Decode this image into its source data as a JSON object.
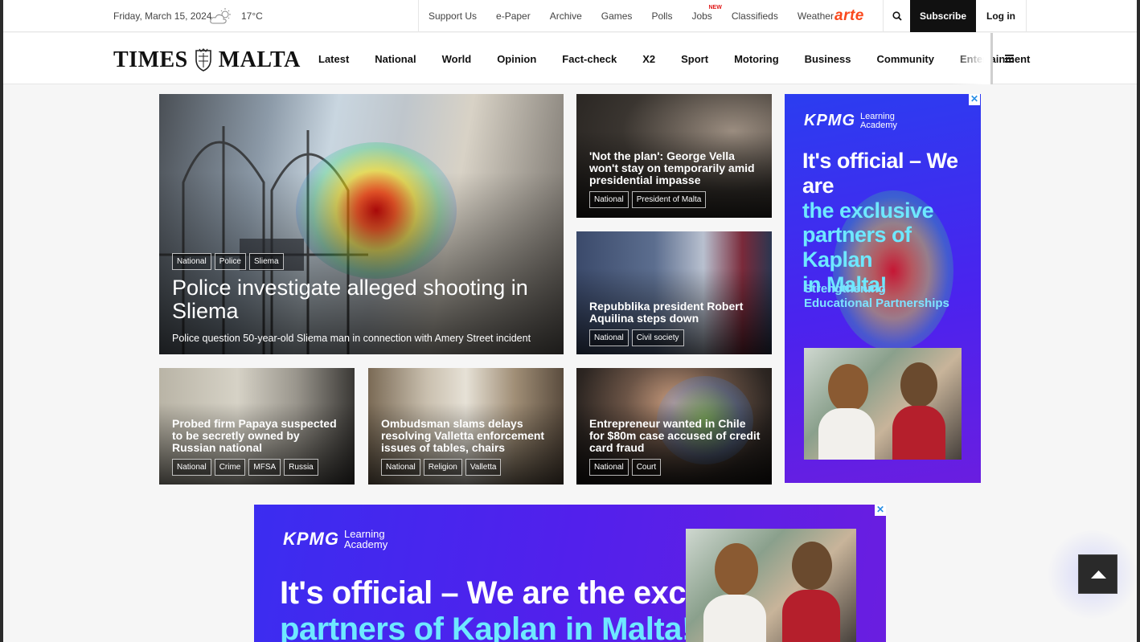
{
  "topbar": {
    "date": "Friday, March 15, 2024",
    "weather_icon": "partly-cloudy-icon",
    "temperature": "17°C",
    "links": [
      {
        "label": "Support Us"
      },
      {
        "label": "e-Paper"
      },
      {
        "label": "Archive"
      },
      {
        "label": "Games"
      },
      {
        "label": "Polls"
      },
      {
        "label": "Jobs",
        "badge": "NEW"
      },
      {
        "label": "Classifieds"
      },
      {
        "label": "Weather"
      }
    ],
    "partner_logo": "arte",
    "subscribe_label": "Subscribe",
    "login_label": "Log in"
  },
  "nav": {
    "logo_left": "TIMES",
    "logo_right": "MALTA",
    "items": [
      {
        "label": "Latest"
      },
      {
        "label": "National"
      },
      {
        "label": "World"
      },
      {
        "label": "Opinion"
      },
      {
        "label": "Fact-check"
      },
      {
        "label": "X2"
      },
      {
        "label": "Sport"
      },
      {
        "label": "Motoring"
      },
      {
        "label": "Business"
      },
      {
        "label": "Community"
      },
      {
        "label": "Entertainment"
      }
    ]
  },
  "articles": {
    "lead": {
      "tags": [
        "National",
        "Police",
        "Sliema"
      ],
      "headline": "Police investigate alleged shooting in Sliema",
      "subhead": "Police question 50-year-old Sliema man in connection with Amery Street incident"
    },
    "vella": {
      "headline": "'Not the plan': George Vella won't stay on temporarily amid presidential impasse",
      "tags": [
        "National",
        "President of Malta"
      ]
    },
    "aquilina": {
      "headline": "Repubblika president Robert Aquilina steps down",
      "tags": [
        "National",
        "Civil society"
      ]
    },
    "papaya": {
      "headline": "Probed firm Papaya suspected to be secretly owned by Russian national",
      "tags": [
        "National",
        "Crime",
        "MFSA",
        "Russia"
      ]
    },
    "ombudsman": {
      "headline": "Ombudsman slams delays resolving Valletta enforcement issues of tables, chairs",
      "tags": [
        "National",
        "Religion",
        "Valletta"
      ]
    },
    "chile": {
      "headline": "Entrepreneur wanted in Chile for $80m case accused of credit card fraud",
      "tags": [
        "National",
        "Court"
      ]
    }
  },
  "ads": {
    "side": {
      "brand": "KPMG",
      "brand_sub_1": "Learning",
      "brand_sub_2": "Academy",
      "headline_1": "It's official – We are",
      "headline_2": "the exclusive",
      "headline_3": "partners of Kaplan",
      "headline_4": "in Malta!",
      "subline_1": "Strengthening",
      "subline_2": "Educational Partnerships",
      "close": "✕"
    },
    "bottom": {
      "brand": "KPMG",
      "brand_sub_1": "Learning",
      "brand_sub_2": "Academy",
      "headline_1": "It's official – We are the exclusive",
      "headline_2": "partners of Kaplan in Malta!",
      "close": "✕"
    }
  },
  "scroll_top_icon": "arrow-up-icon"
}
